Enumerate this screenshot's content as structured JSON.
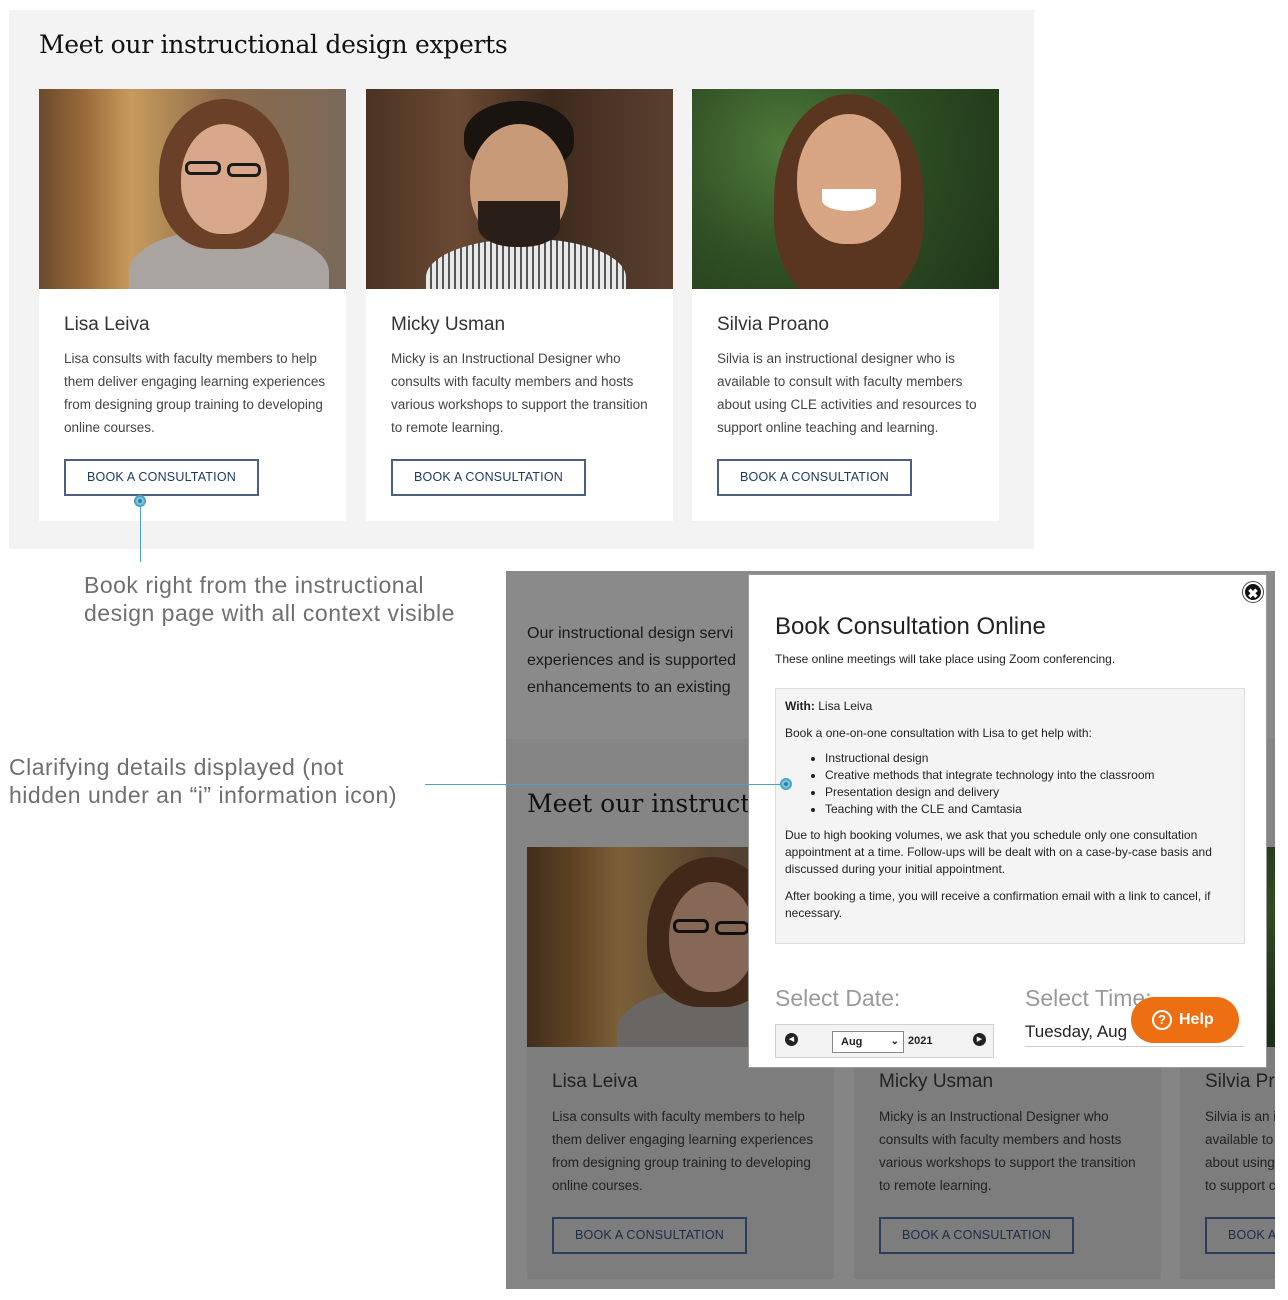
{
  "top": {
    "title": "Meet our instructional design experts",
    "experts": [
      {
        "name": "Lisa Leiva",
        "bio": "Lisa consults with faculty members to help them deliver engaging learning experiences from designing group training to developing online courses.",
        "button": "BOOK A CONSULTATION"
      },
      {
        "name": "Micky Usman",
        "bio": "Micky is an Instructional Designer who consults with faculty members and hosts various workshops to support the transition to remote learning.",
        "button": "BOOK A CONSULTATION"
      },
      {
        "name": "Silvia Proano",
        "bio": "Silvia is an instructional designer who is available to consult with faculty members about using CLE activities and resources to support online teaching and learning.",
        "button": "BOOK A CONSULTATION"
      }
    ]
  },
  "annotations": {
    "note1": "Book right from the instructional design page with all context visible",
    "note2": "Clarifying details displayed (not hidden under an “i” information icon)"
  },
  "background_page": {
    "intro_lines": [
      "Our instructional design servi",
      "experiences and is supported",
      "enhancements to an existing"
    ],
    "title": "Meet our instructional",
    "experts": [
      {
        "name": "Lisa Leiva",
        "bio": "Lisa consults with faculty members to help them deliver engaging learning experiences from designing group training to developing online courses.",
        "button": "BOOK A CONSULTATION"
      },
      {
        "name": "Micky Usman",
        "bio": "Micky is an Instructional Designer who consults with faculty members and hosts various workshops to support the transition to remote learning.",
        "button": "BOOK A CONSULTATION"
      },
      {
        "name": "Silvia Pr",
        "bio": "Silvia is an i available to about using to support c",
        "button": "BOOK A"
      }
    ]
  },
  "modal": {
    "close_glyph": "✖",
    "title": "Book Consultation Online",
    "subtitle": "These online meetings will take place using Zoom conferencing.",
    "with_label": "With:",
    "with_name": "Lisa Leiva",
    "intro": "Book a one-on-one consultation with Lisa to get help with:",
    "topics": [
      "Instructional design",
      "Creative methods that integrate technology into the classroom",
      "Presentation design and delivery",
      "Teaching with the CLE and Camtasia"
    ],
    "policy": "Due to high booking volumes, we ask that you schedule only one consultation appointment at a time. Follow-ups will be dealt with on a case-by-case basis and discussed during your initial appointment.",
    "confirm": "After booking a time, you will receive a confirmation email with a link to cancel, if necessary.",
    "select_date_label": "Select Date:",
    "select_time_label": "Select Time:",
    "month": "Aug",
    "year": "2021",
    "time_value": "Tuesday, Aug"
  },
  "help": {
    "label": "Help",
    "icon_glyph": "?"
  }
}
